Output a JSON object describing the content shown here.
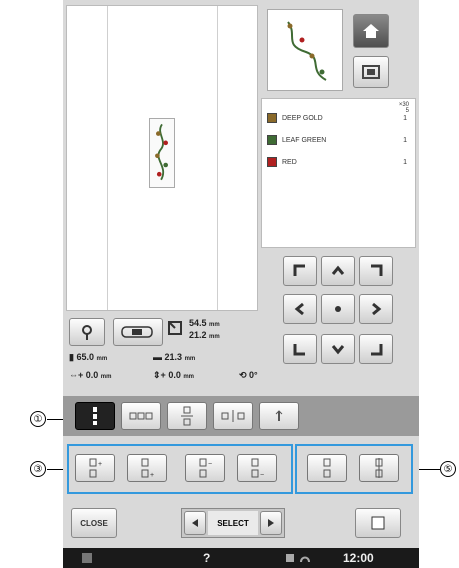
{
  "colors": [
    {
      "name": "DEEP GOLD",
      "count": "1",
      "hex": "#8a6a2a"
    },
    {
      "name": "LEAF GREEN",
      "count": "1",
      "hex": "#3f6b34"
    },
    {
      "name": "RED",
      "count": "1",
      "hex": "#b02020"
    }
  ],
  "stitch_header": {
    "line1": "×30",
    "line2": "5"
  },
  "size": {
    "width": "54.5",
    "height": "21.2",
    "unit": "mm"
  },
  "position": {
    "x": "65.0",
    "y": "21.3",
    "unit": "mm"
  },
  "offset": {
    "x": "0.0",
    "y": "0.0",
    "unit": "mm",
    "angle": "0°"
  },
  "select_label": "SELECT",
  "close_label": "CLOSE",
  "status": {
    "help": "?",
    "time": "12:00"
  },
  "callouts": {
    "c1": "①",
    "c3": "③",
    "c5": "⑤"
  },
  "icons": {
    "home": "home-icon",
    "window": "window-icon",
    "needle": "needle-icon",
    "arrows": [
      "up-left-icon",
      "up-icon",
      "up-right-icon",
      "left-icon",
      "center-icon",
      "right-icon",
      "down-left-icon",
      "down-icon",
      "down-right-icon"
    ]
  }
}
